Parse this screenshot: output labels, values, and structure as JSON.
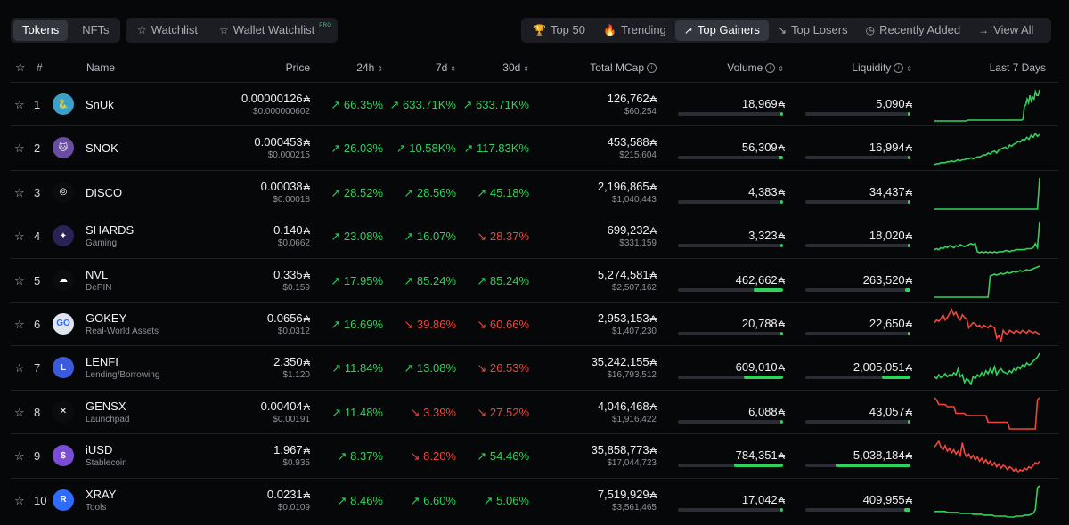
{
  "tabs_left": [
    {
      "label": "Tokens",
      "active": true
    },
    {
      "label": "NFTs",
      "active": false
    }
  ],
  "watch_tabs": [
    {
      "label": "Watchlist",
      "icon": "star-outline-icon"
    },
    {
      "label": "Wallet Watchlist",
      "icon": "star-outline-icon",
      "badge": "PRO"
    }
  ],
  "filters": [
    {
      "label": "Top 50",
      "icon": "trophy-icon",
      "glyph": "🏆",
      "active": false
    },
    {
      "label": "Trending",
      "icon": "flame-icon",
      "glyph": "🔥",
      "active": false
    },
    {
      "label": "Top Gainers",
      "icon": "arrow-up-right-icon",
      "glyph": "↗",
      "active": true
    },
    {
      "label": "Top Losers",
      "icon": "arrow-down-right-icon",
      "glyph": "↘",
      "active": false
    },
    {
      "label": "Recently Added",
      "icon": "clock-icon",
      "glyph": "◷",
      "active": false
    },
    {
      "label": "View All",
      "icon": "arrow-right-icon",
      "glyph": "→",
      "active": false
    }
  ],
  "headers": {
    "rank": "#",
    "name": "Name",
    "price": "Price",
    "h24": "24h",
    "d7": "7d",
    "d30": "30d",
    "mcap": "Total MCap",
    "volume": "Volume",
    "liquidity": "Liquidity",
    "last7": "Last 7 Days"
  },
  "colors": {
    "up": "#2fd35b",
    "down": "#f0463c",
    "accent": "#2fd35b"
  },
  "ada_symbol": "₳",
  "rows": [
    {
      "rank": "1",
      "name": "SnUk",
      "category": "",
      "price": "0.00000126",
      "price_usd": "$0.000000602",
      "h24": "66.35%",
      "h24_dir": "up",
      "d7": "633.71K%",
      "d7_dir": "up",
      "d30": "633.71K%",
      "d30_dir": "up",
      "mcap": "126,762",
      "mcap_usd": "$60,254",
      "volume": "18,969",
      "volume_fill": 0.02,
      "liquidity": "5,090",
      "liquidity_fill": 0.01,
      "trend": "up",
      "logo_color": "#3aa0c8",
      "logo_text": "🐍",
      "spark": [
        2,
        2,
        2,
        2,
        2,
        2,
        2,
        2,
        2,
        2,
        2,
        2,
        2,
        2,
        2,
        2,
        2,
        2,
        2,
        2,
        2,
        2,
        2,
        2,
        3,
        3,
        3,
        3,
        3,
        3,
        3,
        3,
        3,
        3,
        3,
        3,
        3,
        3,
        3,
        3,
        3,
        3,
        3,
        3,
        3,
        3,
        3,
        3,
        3,
        3,
        3,
        3,
        3,
        3,
        3,
        3,
        3,
        3,
        3,
        3,
        3,
        3,
        3,
        3,
        4,
        18,
        20,
        26,
        22,
        30,
        24,
        28,
        26,
        34,
        30,
        30,
        36
      ]
    },
    {
      "rank": "2",
      "name": "SNOK",
      "category": "",
      "price": "0.000453",
      "price_usd": "$0.000215",
      "h24": "26.03%",
      "h24_dir": "up",
      "d7": "10.58K%",
      "d7_dir": "up",
      "d30": "117.83K%",
      "d30_dir": "up",
      "mcap": "453,588",
      "mcap_usd": "$215,604",
      "volume": "56,309",
      "volume_fill": 0.04,
      "liquidity": "16,994",
      "liquidity_fill": 0.01,
      "trend": "up",
      "logo_color": "#6a4ca0",
      "logo_text": "🐱",
      "spark": [
        2,
        3,
        3,
        4,
        4,
        4,
        5,
        5,
        6,
        5,
        6,
        7,
        6,
        7,
        7,
        8,
        8,
        9,
        8,
        9,
        10,
        10,
        11,
        12,
        12,
        14,
        13,
        15,
        16,
        14,
        17,
        18,
        19,
        20,
        18,
        22,
        21,
        23,
        24,
        26,
        25,
        28,
        27,
        30,
        28,
        32,
        30,
        34,
        31,
        33
      ]
    },
    {
      "rank": "3",
      "name": "DISCO",
      "category": "",
      "price": "0.00038",
      "price_usd": "$0.00018",
      "h24": "28.52%",
      "h24_dir": "up",
      "d7": "28.56%",
      "d7_dir": "up",
      "d30": "45.18%",
      "d30_dir": "up",
      "mcap": "2,196,865",
      "mcap_usd": "$1,040,443",
      "volume": "4,383",
      "volume_fill": 0.01,
      "liquidity": "34,437",
      "liquidity_fill": 0.02,
      "trend": "up",
      "logo_color": "#0b0c0e",
      "logo_text": "◎",
      "spark": [
        1,
        1,
        1,
        1,
        1,
        1,
        1,
        1,
        1,
        1,
        1,
        1,
        1,
        1,
        1,
        1,
        1,
        1,
        1,
        1,
        1,
        1,
        1,
        1,
        1,
        1,
        1,
        1,
        1,
        1,
        1,
        1,
        1,
        1,
        1,
        1,
        1,
        1,
        1,
        1,
        1,
        1,
        1,
        1,
        1,
        1,
        1,
        1,
        1,
        36
      ]
    },
    {
      "rank": "4",
      "name": "SHARDS",
      "category": "Gaming",
      "price": "0.140",
      "price_usd": "$0.0662",
      "h24": "23.08%",
      "h24_dir": "up",
      "d7": "16.07%",
      "d7_dir": "up",
      "d30": "28.37%",
      "d30_dir": "down",
      "mcap": "699,232",
      "mcap_usd": "$331,159",
      "volume": "3,323",
      "volume_fill": 0.01,
      "liquidity": "18,020",
      "liquidity_fill": 0.01,
      "trend": "up",
      "logo_color": "#2a2255",
      "logo_text": "✦",
      "spark": [
        8,
        9,
        8,
        10,
        9,
        11,
        10,
        12,
        11,
        10,
        12,
        11,
        13,
        12,
        11,
        12,
        13,
        14,
        13,
        14,
        6,
        5,
        6,
        5,
        6,
        5,
        6,
        5,
        6,
        5,
        6,
        6,
        6,
        7,
        7,
        6,
        7,
        7,
        8,
        8,
        8,
        8,
        8,
        9,
        9,
        9,
        10,
        14,
        10,
        36
      ]
    },
    {
      "rank": "5",
      "name": "NVL",
      "category": "DePIN",
      "price": "0.335",
      "price_usd": "$0.159",
      "h24": "17.95%",
      "h24_dir": "up",
      "d7": "85.24%",
      "d7_dir": "up",
      "d30": "85.24%",
      "d30_dir": "up",
      "mcap": "5,274,581",
      "mcap_usd": "$2,507,162",
      "volume": "462,662",
      "volume_fill": 0.28,
      "liquidity": "263,520",
      "liquidity_fill": 0.05,
      "trend": "up",
      "logo_color": "#0b0c0e",
      "logo_text": "☁",
      "spark": [
        2,
        2,
        2,
        2,
        2,
        2,
        2,
        2,
        2,
        2,
        2,
        2,
        2,
        2,
        2,
        2,
        2,
        2,
        2,
        2,
        2,
        2,
        2,
        2,
        2,
        2,
        26,
        27,
        28,
        27,
        28,
        29,
        28,
        29,
        30,
        29,
        30,
        31,
        30,
        31,
        32,
        31,
        32,
        33,
        32,
        33,
        34,
        35,
        36,
        37
      ]
    },
    {
      "rank": "6",
      "name": "GOKEY",
      "category": "Real-World Assets",
      "price": "0.0656",
      "price_usd": "$0.0312",
      "h24": "16.69%",
      "h24_dir": "up",
      "d7": "39.86%",
      "d7_dir": "down",
      "d30": "60.66%",
      "d30_dir": "down",
      "mcap": "2,953,153",
      "mcap_usd": "$1,407,230",
      "volume": "20,788",
      "volume_fill": 0.01,
      "liquidity": "22,650",
      "liquidity_fill": 0.01,
      "trend": "down",
      "logo_color": "#dfe6f0",
      "logo_text": "GO",
      "spark": [
        24,
        26,
        25,
        27,
        30,
        26,
        28,
        31,
        34,
        30,
        32,
        28,
        26,
        30,
        28,
        27,
        20,
        22,
        24,
        23,
        21,
        22,
        20,
        22,
        21,
        20,
        22,
        21,
        20,
        12,
        14,
        10,
        18,
        16,
        15,
        18,
        17,
        16,
        18,
        17,
        16,
        18,
        17,
        16,
        18,
        17,
        16,
        17,
        16,
        15
      ]
    },
    {
      "rank": "7",
      "name": "LENFI",
      "category": "Lending/Borrowing",
      "price": "2.350",
      "price_usd": "$1.120",
      "h24": "11.84%",
      "h24_dir": "up",
      "d7": "13.08%",
      "d7_dir": "up",
      "d30": "26.53%",
      "d30_dir": "down",
      "mcap": "35,242,155",
      "mcap_usd": "$16,793,512",
      "volume": "609,010",
      "volume_fill": 0.37,
      "liquidity": "2,005,051",
      "liquidity_fill": 0.27,
      "trend": "up",
      "logo_color": "#3b5bdb",
      "logo_text": "L",
      "spark": [
        14,
        12,
        16,
        13,
        15,
        17,
        14,
        16,
        15,
        18,
        16,
        22,
        14,
        16,
        8,
        12,
        10,
        6,
        14,
        12,
        16,
        14,
        18,
        15,
        20,
        17,
        22,
        18,
        24,
        16,
        20,
        22,
        19,
        18,
        17,
        20,
        18,
        22,
        20,
        24,
        22,
        26,
        24,
        28,
        26,
        27,
        30,
        32,
        34,
        38
      ]
    },
    {
      "rank": "8",
      "name": "GENSX",
      "category": "Launchpad",
      "price": "0.00404",
      "price_usd": "$0.00191",
      "h24": "11.48%",
      "h24_dir": "up",
      "d7": "3.39%",
      "d7_dir": "down",
      "d30": "27.52%",
      "d30_dir": "down",
      "mcap": "4,046,468",
      "mcap_usd": "$1,916,422",
      "volume": "6,088",
      "volume_fill": 0.01,
      "liquidity": "43,057",
      "liquidity_fill": 0.02,
      "trend": "down",
      "logo_color": "#0b0c0e",
      "logo_text": "✕",
      "spark": [
        36,
        34,
        30,
        30,
        30,
        30,
        28,
        28,
        28,
        28,
        22,
        22,
        22,
        22,
        22,
        20,
        20,
        20,
        20,
        20,
        20,
        20,
        20,
        20,
        20,
        14,
        14,
        14,
        14,
        14,
        14,
        14,
        14,
        14,
        14,
        8,
        8,
        8,
        8,
        8,
        8,
        8,
        8,
        8,
        8,
        8,
        8,
        8,
        34,
        36
      ]
    },
    {
      "rank": "9",
      "name": "iUSD",
      "category": "Stablecoin",
      "price": "1.967",
      "price_usd": "$0.935",
      "h24": "8.37%",
      "h24_dir": "up",
      "d7": "8.20%",
      "d7_dir": "down",
      "d30": "54.46%",
      "d30_dir": "up",
      "mcap": "35,858,773",
      "mcap_usd": "$17,044,723",
      "volume": "784,351",
      "volume_fill": 0.47,
      "liquidity": "5,038,184",
      "liquidity_fill": 0.7,
      "trend": "down",
      "logo_color": "#7b4dd6",
      "logo_text": "$",
      "spark": [
        30,
        32,
        34,
        30,
        28,
        31,
        27,
        29,
        26,
        28,
        25,
        27,
        24,
        33,
        26,
        23,
        25,
        22,
        24,
        21,
        23,
        20,
        22,
        19,
        21,
        18,
        20,
        17,
        19,
        16,
        18,
        15,
        17,
        16,
        14,
        16,
        15,
        13,
        15,
        12,
        14,
        13,
        15,
        14,
        16,
        15,
        17,
        19,
        18,
        20
      ]
    },
    {
      "rank": "10",
      "name": "XRAY",
      "category": "Tools",
      "price": "0.0231",
      "price_usd": "$0.0109",
      "h24": "8.46%",
      "h24_dir": "up",
      "d7": "6.60%",
      "d7_dir": "up",
      "d30": "5.06%",
      "d30_dir": "up",
      "mcap": "7,519,929",
      "mcap_usd": "$3,561,465",
      "volume": "17,042",
      "volume_fill": 0.01,
      "liquidity": "409,955",
      "liquidity_fill": 0.06,
      "trend": "up",
      "logo_color": "#2f6bff",
      "logo_text": "R",
      "spark": [
        8,
        8,
        8,
        8,
        8,
        8,
        7,
        7,
        7,
        7,
        7,
        7,
        6,
        6,
        6,
        6,
        6,
        6,
        5,
        5,
        5,
        5,
        5,
        4,
        4,
        4,
        4,
        4,
        3,
        3,
        3,
        3,
        3,
        3,
        2,
        2,
        2,
        2,
        3,
        3,
        3,
        3,
        4,
        4,
        4,
        5,
        6,
        10,
        34,
        36
      ]
    }
  ]
}
